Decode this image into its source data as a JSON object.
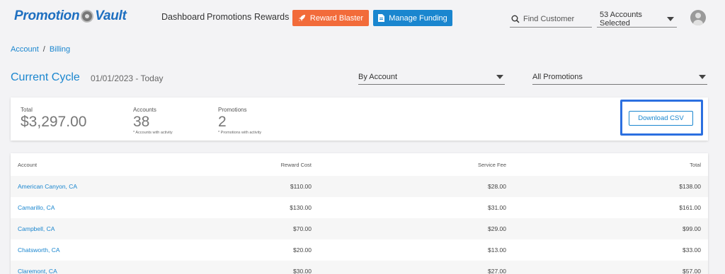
{
  "brand": {
    "logo_left": "Promotion",
    "logo_right": "Vault"
  },
  "nav": {
    "links": [
      "Dashboard",
      "Promotions",
      "Rewards"
    ],
    "reward_blaster": "Reward Blaster",
    "manage_funding": "Manage Funding",
    "search_placeholder": "Find Customer",
    "accounts_selected": "53 Accounts Selected"
  },
  "breadcrumb": {
    "account": "Account",
    "separator": "/",
    "billing": "Billing"
  },
  "cycle": {
    "title": "Current Cycle",
    "range": "01/01/2023 - Today",
    "view_filter": "By Account",
    "promo_filter": "All Promotions"
  },
  "summary": {
    "total_label": "Total",
    "total_value": "$3,297.00",
    "accounts_label": "Accounts",
    "accounts_value": "38",
    "accounts_note": "* Accounts with activity",
    "promotions_label": "Promotions",
    "promotions_value": "2",
    "promotions_note": "* Promotions with activity",
    "download_csv": "Download CSV"
  },
  "table": {
    "headers": {
      "account": "Account",
      "reward_cost": "Reward Cost",
      "service_fee": "Service Fee",
      "total": "Total"
    },
    "rows": [
      {
        "account": "American Canyon, CA",
        "reward_cost": "$110.00",
        "service_fee": "$28.00",
        "total": "$138.00"
      },
      {
        "account": "Camarillo, CA",
        "reward_cost": "$130.00",
        "service_fee": "$31.00",
        "total": "$161.00"
      },
      {
        "account": "Campbell, CA",
        "reward_cost": "$70.00",
        "service_fee": "$29.00",
        "total": "$99.00"
      },
      {
        "account": "Chatsworth, CA",
        "reward_cost": "$20.00",
        "service_fee": "$13.00",
        "total": "$33.00"
      },
      {
        "account": "Claremont, CA",
        "reward_cost": "$30.00",
        "service_fee": "$27.00",
        "total": "$57.00"
      }
    ]
  },
  "colors": {
    "brand_blue": "#1a86cf",
    "reward_orange": "#f26b3a",
    "highlight_blue": "#2b6fe0"
  },
  "icons": [
    "rocket-icon",
    "document-icon",
    "search-icon",
    "chevron-down-icon",
    "user-avatar-icon",
    "vault-dial-icon"
  ]
}
